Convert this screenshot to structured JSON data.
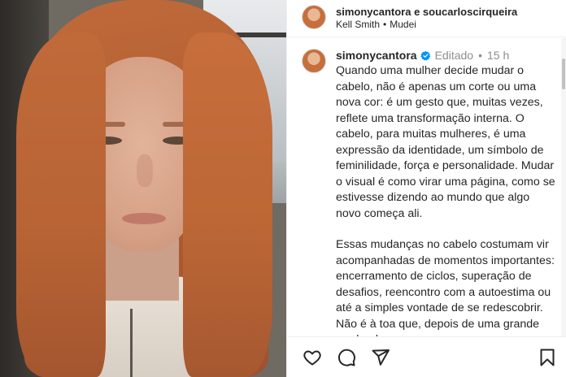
{
  "post": {
    "header": {
      "title": "simonycantora e soucarloscirqueira",
      "music_artist": "Kell Smith",
      "separator": "•",
      "music_title": "Mudei"
    },
    "caption": {
      "username": "simonycantora",
      "edited": "Editado",
      "separator": "•",
      "time": "15 h",
      "paragraphs": [
        "Quando uma mulher decide mudar o cabelo, não é apenas um corte ou uma nova cor: é um gesto que, muitas vezes, reflete uma transformação interna. O cabelo, para muitas mulheres, é uma expressão da identidade, um símbolo de feminilidade, força e personalidade. Mudar o visual é como virar uma página, como se estivesse dizendo ao mundo que algo novo começa ali.",
        "Essas mudanças no cabelo costumam vir acompanhadas de momentos importantes: encerramento de ciclos, superação de desafios, reencontro com a autoestima ou até a simples vontade de se redescobrir. Não é à toa que, depois de uma grande perda, de uma"
      ]
    },
    "actions": {
      "icons": [
        "heart-icon",
        "comment-icon",
        "share-icon",
        "bookmark-icon"
      ]
    }
  },
  "colors": {
    "text": "#262626",
    "muted": "#8e8e8e",
    "verified": "#0095f6",
    "border": "#efefef"
  }
}
